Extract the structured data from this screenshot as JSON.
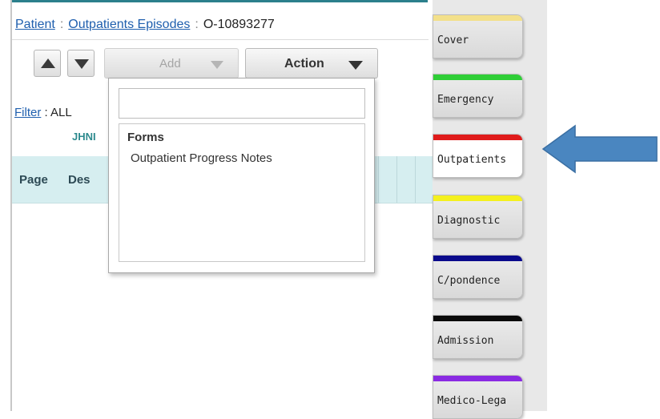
{
  "breadcrumb": {
    "patient": "Patient",
    "sep1": ":",
    "episodes": "Outpatients Episodes",
    "sep2": ":",
    "episode_id": "O-10893277"
  },
  "toolbar": {
    "add_label": "Add",
    "action_label": "Action"
  },
  "filter": {
    "label": "Filter",
    "sep": ":",
    "value": "ALL",
    "sub_value": "JHNI"
  },
  "table": {
    "columns": [
      "Page",
      "Des"
    ]
  },
  "dropdown": {
    "search_value": "",
    "group_label": "Forms",
    "items": [
      "Outpatient Progress Notes"
    ]
  },
  "tabs": [
    {
      "label": "Cover",
      "color": "#f3e08a",
      "active": false
    },
    {
      "label": "Emergency",
      "color": "#2fce37",
      "active": false
    },
    {
      "label": "Outpatients",
      "color": "#e01b1b",
      "active": true
    },
    {
      "label": "Diagnostic",
      "color": "#f4f01e",
      "active": false
    },
    {
      "label": "C/pondence",
      "color": "#0a0a8c",
      "active": false
    },
    {
      "label": "Admission",
      "color": "#0a0a0a",
      "active": false
    },
    {
      "label": "Medico-Lega",
      "color": "#8a2be2",
      "active": false
    }
  ],
  "colors": {
    "link": "#1f5fae",
    "header_bg": "#d6eef0",
    "annotation_arrow": "#4a86c0"
  },
  "icons": {
    "move_up": "triangle-up-icon",
    "move_down": "triangle-down-icon",
    "dropdown_caret": "caret-down-icon",
    "annotation": "left-arrow-icon"
  }
}
